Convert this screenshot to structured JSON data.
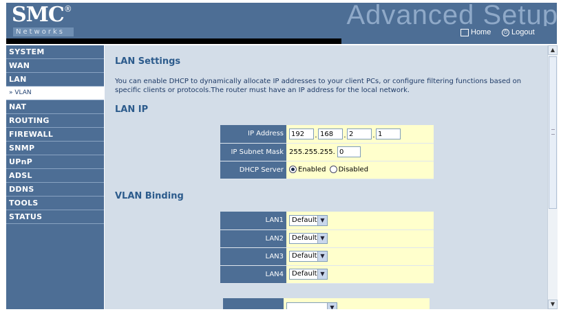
{
  "header": {
    "logo": "SMC",
    "logo_mark": "®",
    "subtitle": "Networks",
    "banner": "Advanced Setup",
    "home_icon": "home-icon",
    "home": "Home",
    "logout_icon": "logout-icon",
    "logout": "Logout"
  },
  "sidebar": {
    "items": [
      "SYSTEM",
      "WAN",
      "LAN",
      "» VLAN",
      "NAT",
      "ROUTING",
      "FIREWALL",
      "SNMP",
      "UPnP",
      "ADSL",
      "DDNS",
      "TOOLS",
      "STATUS"
    ]
  },
  "main": {
    "title": "LAN Settings",
    "description": "You can enable DHCP to dynamically allocate IP addresses to your client PCs, or configure filtering functions based on specific clients or protocols.The router must have an IP address for the local network.",
    "lan_ip_heading": "LAN IP",
    "ip_address_label": "IP Address",
    "ip": [
      "192",
      "168",
      "2",
      "1"
    ],
    "subnet_label": "IP Subnet Mask",
    "subnet_prefix": "255.255.255.",
    "subnet_last": "0",
    "dhcp_label": "DHCP Server",
    "dhcp_enabled": "Enabled",
    "dhcp_disabled": "Disabled",
    "dhcp_selected": "Enabled",
    "vlan_heading": "VLAN Binding",
    "vlan_rows": [
      {
        "label": "LAN1",
        "value": "Default"
      },
      {
        "label": "LAN2",
        "value": "Default"
      },
      {
        "label": "LAN3",
        "value": "Default"
      },
      {
        "label": "LAN4",
        "value": "Default"
      }
    ]
  },
  "colors": {
    "nav_bg": "#4d6e95",
    "content_bg": "#d3dde8",
    "value_bg": "#ffffcc",
    "heading": "#2c5b8c"
  }
}
